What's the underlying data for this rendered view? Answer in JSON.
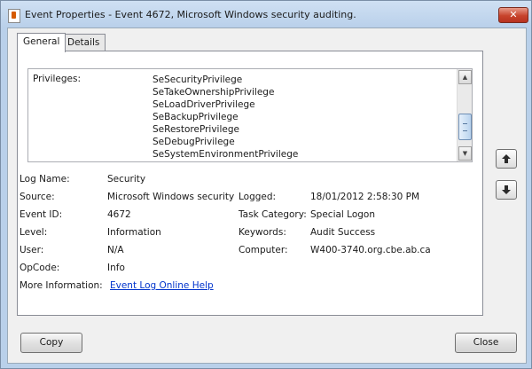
{
  "window": {
    "title": "Event Properties - Event 4672, Microsoft Windows security auditing.",
    "close_glyph": "✕"
  },
  "tabs": [
    {
      "label": "General",
      "active": true
    },
    {
      "label": "Details",
      "active": false
    }
  ],
  "description": {
    "label": "Privileges:",
    "privileges": [
      "SeSecurityPrivilege",
      "SeTakeOwnershipPrivilege",
      "SeLoadDriverPrivilege",
      "SeBackupPrivilege",
      "SeRestorePrivilege",
      "SeDebugPrivilege",
      "SeSystemEnvironmentPrivilege"
    ]
  },
  "details": {
    "log_name_label": "Log Name:",
    "log_name": "Security",
    "source_label": "Source:",
    "source": "Microsoft Windows security",
    "logged_label": "Logged:",
    "logged": "18/01/2012 2:58:30 PM",
    "event_id_label": "Event ID:",
    "event_id": "4672",
    "task_category_label": "Task Category:",
    "task_category": "Special Logon",
    "level_label": "Level:",
    "level": "Information",
    "keywords_label": "Keywords:",
    "keywords": "Audit Success",
    "user_label": "User:",
    "user": "N/A",
    "computer_label": "Computer:",
    "computer": "W400-3740.org.cbe.ab.ca",
    "opcode_label": "OpCode:",
    "opcode": "Info",
    "more_info_label": "More Information:",
    "more_info_link": "Event Log Online Help"
  },
  "buttons": {
    "copy": "Copy",
    "close": "Close"
  },
  "icons": {
    "up": "arrow-up-icon",
    "down": "arrow-down-icon"
  }
}
